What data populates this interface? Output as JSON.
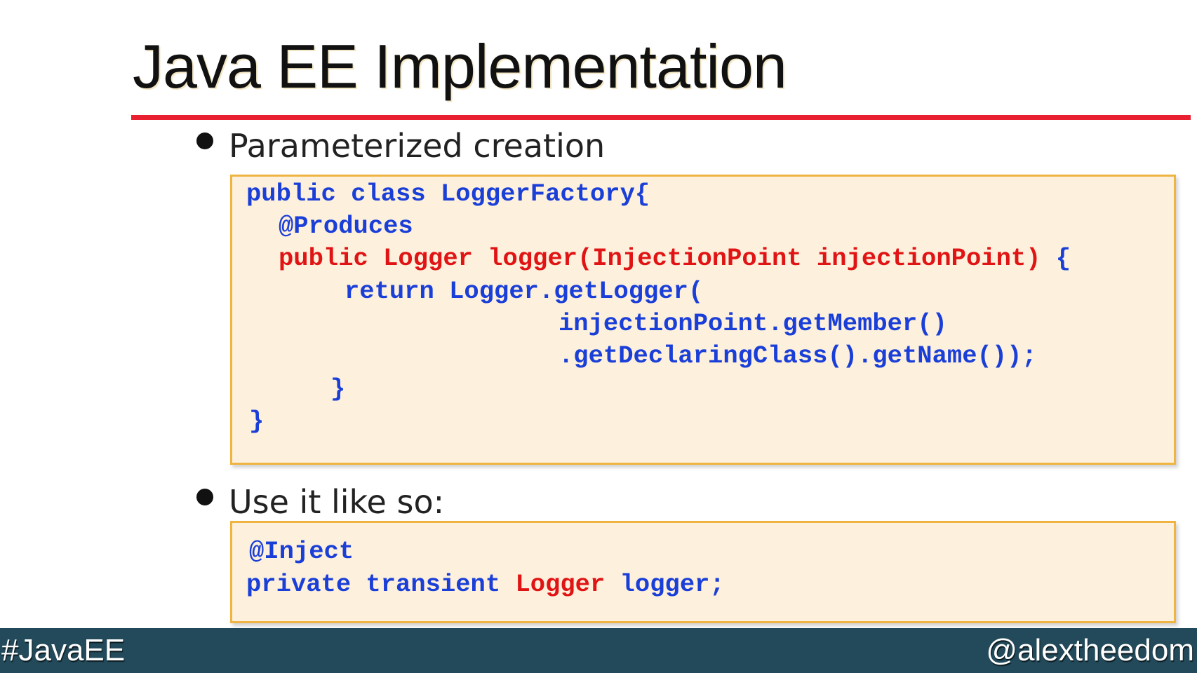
{
  "title": "Java EE Implementation",
  "bullets": [
    {
      "text": "Parameterized creation"
    },
    {
      "text": "Use it like so:"
    }
  ],
  "code_block_1": {
    "line1": "public class LoggerFactory{",
    "line2": "@Produces",
    "line3_red": "public Logger logger(InjectionPoint injectionPoint)",
    "line3_blue": " {",
    "line4": "return Logger.getLogger(",
    "line5": "injectionPoint.getMember()",
    "line6": ".getDeclaringClass().getName());",
    "line7": "}",
    "line8": "}"
  },
  "code_block_2": {
    "line1": "@Inject",
    "line2_a": "private transient ",
    "line2_red": "Logger",
    "line2_b": " logger;"
  },
  "footer": {
    "hashtag": "#JavaEE",
    "handle": "@alextheedom"
  },
  "colors": {
    "accent_rule": "#e8202f",
    "code_keyword_blue": "#1a3fd8",
    "code_highlight_red": "#e01414",
    "code_background": "#fdf0dc",
    "code_border": "#efb442",
    "footer_background": "#234a5a"
  }
}
